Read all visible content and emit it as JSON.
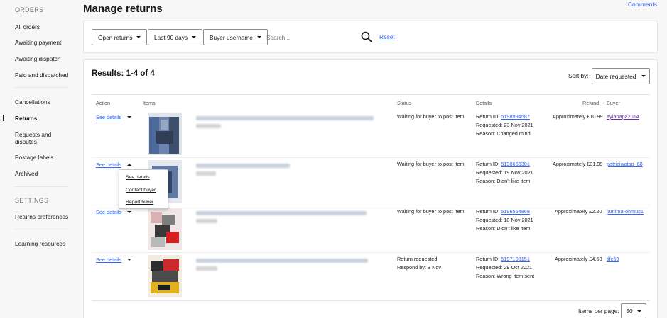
{
  "sidebar": {
    "orders_heading": "ORDERS",
    "settings_heading": "SETTINGS",
    "items": [
      {
        "label": "All orders"
      },
      {
        "label": "Awaiting payment"
      },
      {
        "label": "Awaiting dispatch"
      },
      {
        "label": "Paid and dispatched"
      },
      {
        "label": "Cancellations"
      },
      {
        "label": "Returns",
        "active": true
      },
      {
        "label": "Requests and disputes"
      },
      {
        "label": "Postage labels"
      },
      {
        "label": "Archived"
      },
      {
        "label": "Returns preferences"
      },
      {
        "label": "Learning resources"
      }
    ]
  },
  "header": {
    "title": "Manage returns",
    "comments": "Comments"
  },
  "filters": {
    "status": "Open returns",
    "period": "Last 90 days",
    "field": "Buyer username",
    "search_placeholder": "Search...",
    "reset": "Reset"
  },
  "results": {
    "title": "Results: 1-4 of 4",
    "sort_label": "Sort by:",
    "sort_value": "Date requested",
    "columns": [
      "Action",
      "Items",
      "Status",
      "Details",
      "Refund",
      "Buyer"
    ],
    "rows": [
      {
        "action": "See details",
        "status": [
          "Waiting for buyer to post item"
        ],
        "return_id_label": "Return ID:",
        "return_id": "5198994587",
        "requested": "Requested: 23 Nov 2021",
        "reason": "Reason: Changed mind",
        "refund": "Approximately £10.99",
        "buyer": "ayianapa2014"
      },
      {
        "action": "See details",
        "status": [
          "Waiting for buyer to post item"
        ],
        "return_id_label": "Return ID:",
        "return_id": "5198666301",
        "requested": "Requested: 19 Nov 2021",
        "reason": "Reason: Didn't like item",
        "refund": "Approximately £31.99",
        "buyer": "patriciwatso_68"
      },
      {
        "action": "See details",
        "status": [
          "Waiting for buyer to post item"
        ],
        "return_id_label": "Return ID:",
        "return_id": "5196564868",
        "requested": "Requested: 18 Nov 2021",
        "reason": "Reason: Didn't like item",
        "refund": "Approximately £2.20",
        "buyer": "jamima-ohmus1"
      },
      {
        "action": "See details",
        "status": [
          "Return requested",
          "Respond by: 3 Nov"
        ],
        "return_id_label": "Return ID:",
        "return_id": "5197103151",
        "requested": "Requested: 29 Oct 2021",
        "reason": "Reason: Wrong item sent",
        "refund": "Approximately £4.50",
        "buyer": "tlfc59"
      }
    ],
    "action_menu": [
      "See details",
      "Contact buyer",
      "Report buyer"
    ],
    "items_per_page_label": "Items per page:",
    "items_per_page": "50"
  },
  "colors": {
    "link": "#3665f3",
    "background": "#f7f7f7",
    "card": "#ffffff"
  }
}
